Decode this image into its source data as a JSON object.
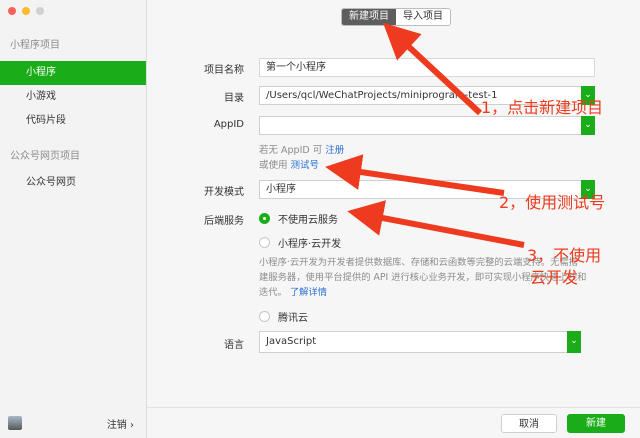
{
  "window": {
    "traffic_colors": [
      "#fc5f57",
      "#fdbb2e",
      "#d0d0d0"
    ]
  },
  "sidebar": {
    "section1": "小程序项目",
    "items1": [
      "小程序",
      "小游戏",
      "代码片段"
    ],
    "section2": "公众号网页项目",
    "items2": [
      "公众号网页"
    ],
    "logout": "注销 ›"
  },
  "tabs": {
    "new": "新建项目",
    "import": "导入项目"
  },
  "form": {
    "name_label": "项目名称",
    "name_value": "第一个小程序",
    "dir_label": "目录",
    "dir_value": "/Users/qcl/WeChatProjects/miniprogram-test-1",
    "appid_label": "AppID",
    "appid_value": "",
    "hint1_prefix": "若无 AppID 可",
    "hint1_link": "注册",
    "hint2_prefix": "或使用",
    "hint2_link": "测试号",
    "mode_label": "开发模式",
    "mode_value": "小程序",
    "backend_label": "后端服务",
    "backend_opt1": "不使用云服务",
    "backend_opt2": "小程序·云开发",
    "cloud_desc_1": "小程序·云开发为开发者提供数据库、存储和云函数等完整的云端支持。无需搭",
    "cloud_desc_2": "建服务器，使用平台提供的 API 进行核心业务开发，即可实现小程序快速上线和",
    "cloud_desc_3": "迭代。",
    "cloud_more": "了解详情",
    "backend_opt3": "腾讯云",
    "lang_label": "语言",
    "lang_value": "JavaScript"
  },
  "buttons": {
    "cancel": "取消",
    "create": "新建"
  },
  "annotations": {
    "a1": "1，点击新建项目",
    "a2": "2，使用测试号",
    "a3_line1": "3，不使用",
    "a3_line2": "云开发",
    "color": "#ee3a1e"
  }
}
